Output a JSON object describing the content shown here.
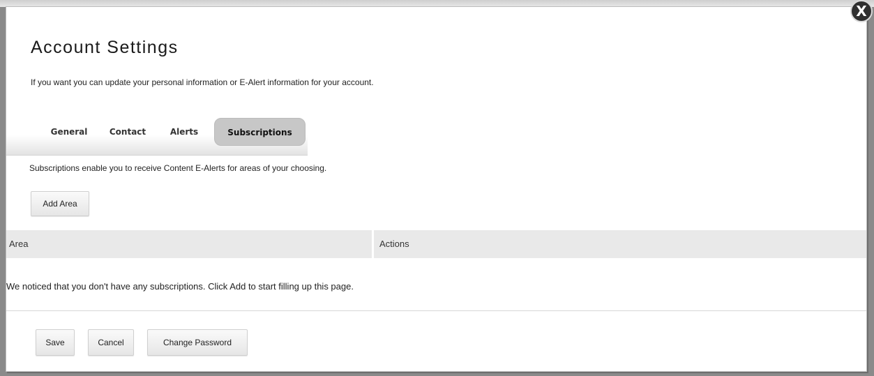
{
  "dialog": {
    "close_label": "X"
  },
  "page": {
    "title": "Account Settings",
    "intro": "If you want you can update your personal information or E-Alert information for your account."
  },
  "tabs": [
    {
      "label": "General",
      "active": false
    },
    {
      "label": "Contact",
      "active": false
    },
    {
      "label": "Alerts",
      "active": false
    },
    {
      "label": "Subscriptions",
      "active": true
    }
  ],
  "subscriptions": {
    "description": "Subscriptions enable you to receive Content E-Alerts for areas of your choosing.",
    "add_button": "Add Area",
    "columns": [
      "Area",
      "Actions"
    ],
    "empty_message": "We noticed that you don't have any subscriptions. Click Add to start filling up this page."
  },
  "footer": {
    "save": "Save",
    "cancel": "Cancel",
    "change_password": "Change Password"
  }
}
